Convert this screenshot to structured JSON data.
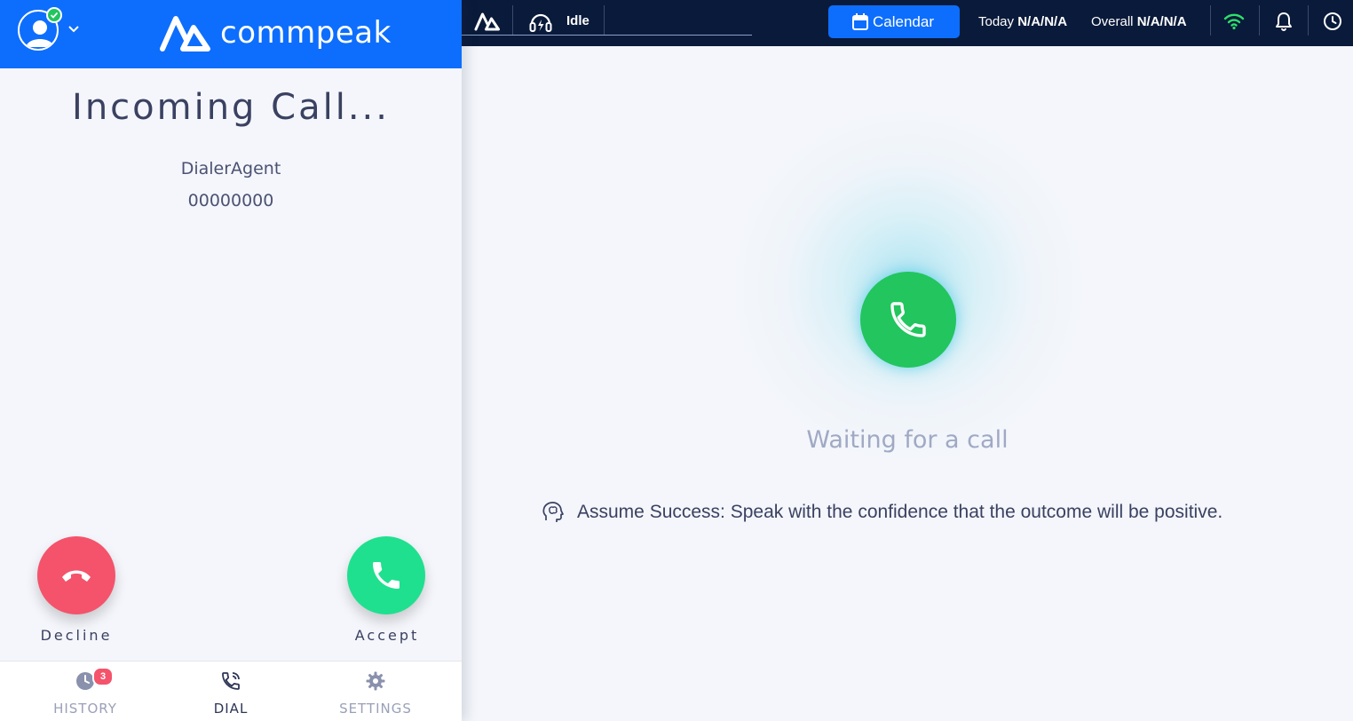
{
  "dialer": {
    "brand": "commpeak",
    "call_title": "Incoming Call...",
    "caller_name": "DialerAgent",
    "caller_number": "00000000",
    "decline_label": "Decline",
    "accept_label": "Accept",
    "nav": {
      "history": "HISTORY",
      "history_badge": "3",
      "dial": "DIAL",
      "settings": "SETTINGS"
    }
  },
  "topbar": {
    "status": "Idle",
    "calendar_label": "Calendar",
    "today_label": "Today",
    "today_value": "N/A/N/A",
    "overall_label": "Overall",
    "overall_value": "N/A/N/A"
  },
  "main": {
    "waiting_text": "Waiting for a call",
    "tip_text": "Assume Success: Speak with the confidence that the outcome will be positive."
  },
  "colors": {
    "brand_blue": "#0d6efd",
    "topbar_navy": "#0a1a3a",
    "decline_red": "#f4536b",
    "accept_green": "#1fe08f",
    "call_green": "#22c55e",
    "wifi_green": "#2ee06b"
  }
}
